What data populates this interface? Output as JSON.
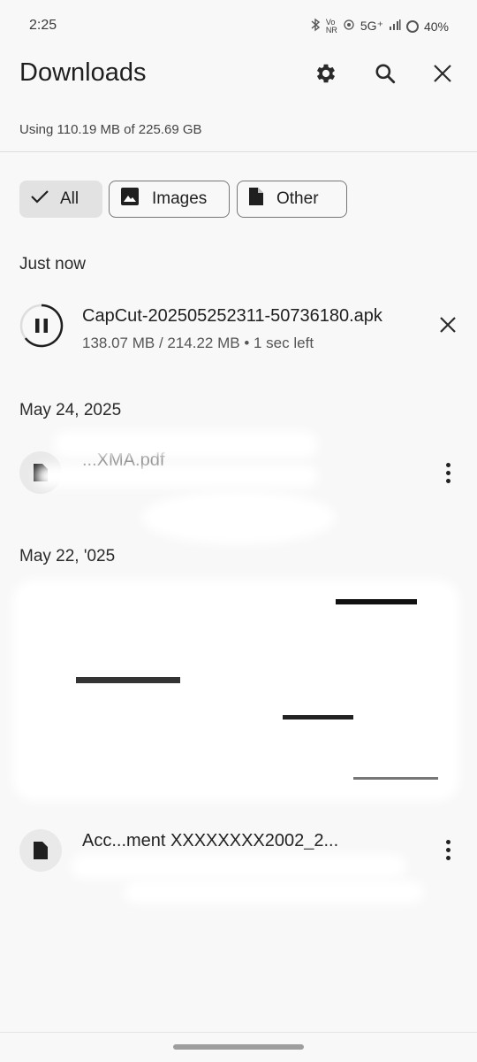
{
  "status_bar": {
    "time": "2:25",
    "network": "5G⁺",
    "vo_top": "Vo",
    "vo_bottom": "NR",
    "battery": "40%"
  },
  "header": {
    "title": "Downloads",
    "settings_icon": "gear-icon",
    "search_icon": "search-icon",
    "close_icon": "close-icon"
  },
  "storage_text": "Using 110.19 MB of 225.69 GB",
  "filters": [
    {
      "label": "All",
      "icon": "check-icon",
      "selected": true
    },
    {
      "label": "Images",
      "icon": "image-icon",
      "selected": false
    },
    {
      "label": "Other",
      "icon": "file-icon",
      "selected": false
    }
  ],
  "sections": {
    "just_now": "Just now",
    "may24": "May 24, 2025",
    "may22": "May 22, '025"
  },
  "active_download": {
    "name": "CapCut-202505252311-50736180.apk",
    "meta": "138.07 MB / 214.22 MB • 1 sec left",
    "progress": 0.6445
  },
  "items": [
    {
      "name_partial": "...XMA.pdf",
      "icon": "document-icon"
    },
    {
      "name_partial": "Acc...ment XXXXXXXX2002_2...",
      "icon": "document-icon"
    }
  ],
  "colors": {
    "background": "#f8f8f8",
    "chip_selected": "#e2e2e2",
    "text": "#1f1f1f"
  }
}
